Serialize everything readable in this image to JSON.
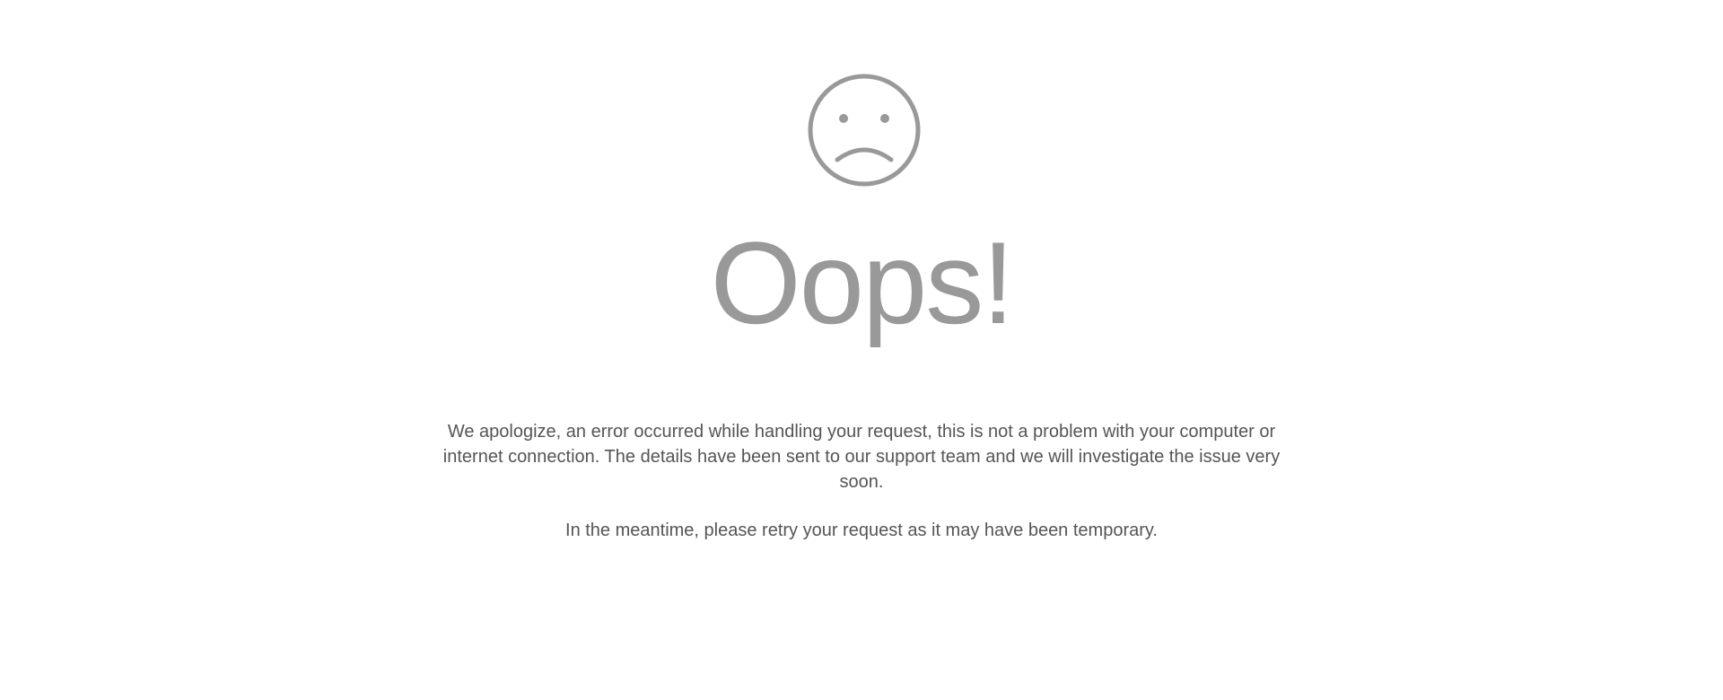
{
  "error_page": {
    "icon": "sad-face-icon",
    "title": "Oops!",
    "message": "We apologize, an error occurred while handling your request, this is not a problem with your computer or internet connection. The details have been sent to our support team and we will investigate the issue very soon.",
    "retry_message": "In the meantime, please retry your request as it may have been temporary.",
    "colors": {
      "icon": "#999999",
      "title": "#999999",
      "text": "#555555",
      "background": "#ffffff"
    }
  }
}
